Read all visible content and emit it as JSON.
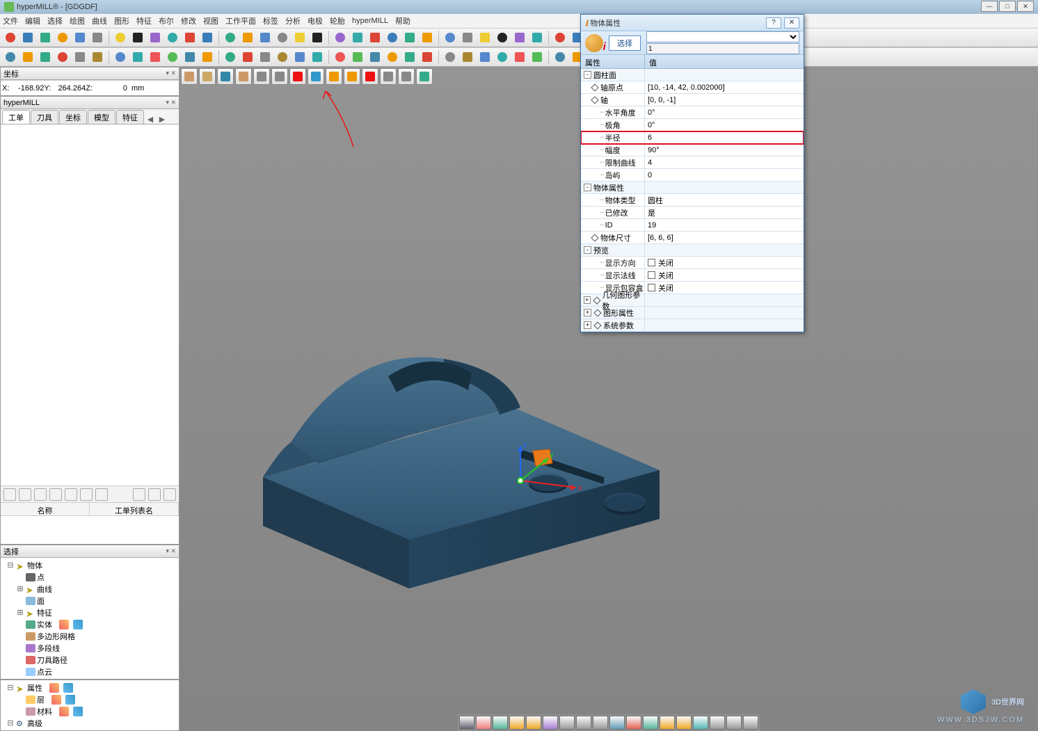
{
  "window": {
    "title": "hyperMILL® - [GDGDF]"
  },
  "menu": [
    "文件",
    "编辑",
    "选择",
    "绘图",
    "曲线",
    "图形",
    "特征",
    "布尔",
    "修改",
    "视图",
    "工作平面",
    "标签",
    "分析",
    "电极",
    "轮胎",
    "hyperMILL",
    "帮助"
  ],
  "coordPanel": {
    "title": "坐标",
    "x_label": "X:",
    "x": "-168.92",
    "y_label": "Y:",
    "y": "264.264",
    "z_label": "Z:",
    "z": "0",
    "unit": "mm"
  },
  "hmPanel": {
    "title": "hyperMILL",
    "tabs": [
      "工单",
      "刀具",
      "坐标",
      "模型",
      "特征"
    ],
    "listCols": [
      "名称",
      "工单列表名"
    ]
  },
  "selPanel": {
    "title": "选择",
    "tree": [
      {
        "d": 0,
        "exp": "-",
        "ic": "pointer",
        "label": "物体"
      },
      {
        "d": 1,
        "exp": "",
        "ic": "dot",
        "label": "点"
      },
      {
        "d": 1,
        "exp": "+",
        "ic": "pointer",
        "label": "曲线"
      },
      {
        "d": 1,
        "exp": "",
        "ic": "face",
        "label": "面"
      },
      {
        "d": 1,
        "exp": "+",
        "ic": "pointer",
        "label": "特征"
      },
      {
        "d": 1,
        "exp": "",
        "ic": "solid",
        "label": "实体",
        "tool": true
      },
      {
        "d": 1,
        "exp": "",
        "ic": "mesh",
        "label": "多边形网格"
      },
      {
        "d": 1,
        "exp": "",
        "ic": "poly",
        "label": "多段线"
      },
      {
        "d": 1,
        "exp": "",
        "ic": "path",
        "label": "刀具路径"
      },
      {
        "d": 1,
        "exp": "",
        "ic": "cloud",
        "label": "点云"
      }
    ]
  },
  "lowerPanel": {
    "tree": [
      {
        "d": 0,
        "exp": "-",
        "ic": "pointer",
        "label": "属性",
        "tool": true
      },
      {
        "d": 1,
        "exp": "",
        "ic": "layer",
        "label": "层",
        "tool": true
      },
      {
        "d": 1,
        "exp": "",
        "ic": "mat",
        "label": "材料",
        "tool": true
      },
      {
        "d": 0,
        "exp": "-",
        "ic": "gear",
        "label": "高级"
      }
    ]
  },
  "dialog": {
    "title": "物体属性",
    "selectBtn": "选择",
    "inputVal": "1",
    "headKey": "属性",
    "headVal": "值",
    "rows": [
      {
        "d": 0,
        "type": "group",
        "k": "圆柱面",
        "v": ""
      },
      {
        "d": 1,
        "type": "diamond",
        "k": "轴原点",
        "v": "[10, -14, 42, 0.002000]"
      },
      {
        "d": 1,
        "type": "diamond",
        "k": "轴",
        "v": "[0, 0, -1]"
      },
      {
        "d": 2,
        "type": "leaf",
        "k": "水平角度",
        "v": "0°"
      },
      {
        "d": 2,
        "type": "leaf",
        "k": "极角",
        "v": "0°"
      },
      {
        "d": 2,
        "type": "leaf",
        "k": "半径",
        "v": "6",
        "hl": true
      },
      {
        "d": 2,
        "type": "leaf",
        "k": "幅度",
        "v": "90°"
      },
      {
        "d": 2,
        "type": "leaf",
        "k": "限制曲线",
        "v": "4"
      },
      {
        "d": 2,
        "type": "leaf",
        "k": "岛屿",
        "v": "0"
      },
      {
        "d": 0,
        "type": "group",
        "k": "物体属性",
        "v": ""
      },
      {
        "d": 2,
        "type": "leaf",
        "k": "物体类型",
        "v": "圆柱"
      },
      {
        "d": 2,
        "type": "leaf",
        "k": "已修改",
        "v": "是"
      },
      {
        "d": 2,
        "type": "leaf",
        "k": "ID",
        "v": "19"
      },
      {
        "d": 1,
        "type": "diamond",
        "k": "物体尺寸",
        "v": "[6, 6, 6]"
      },
      {
        "d": 0,
        "type": "group",
        "k": "预览",
        "v": ""
      },
      {
        "d": 2,
        "type": "check",
        "k": "显示方向",
        "v": "关闭"
      },
      {
        "d": 2,
        "type": "check",
        "k": "显示法线",
        "v": "关闭"
      },
      {
        "d": 2,
        "type": "check",
        "k": "显示包容盒",
        "v": "关闭"
      },
      {
        "d": 0,
        "type": "closed",
        "k": "几何图形参数",
        "v": ""
      },
      {
        "d": 0,
        "type": "closed",
        "k": "图形属性",
        "v": ""
      },
      {
        "d": 0,
        "type": "closed",
        "k": "系统参数",
        "v": ""
      }
    ]
  },
  "watermark": {
    "text": "3D世界网",
    "sub": "WWW.3DSJW.COM"
  }
}
